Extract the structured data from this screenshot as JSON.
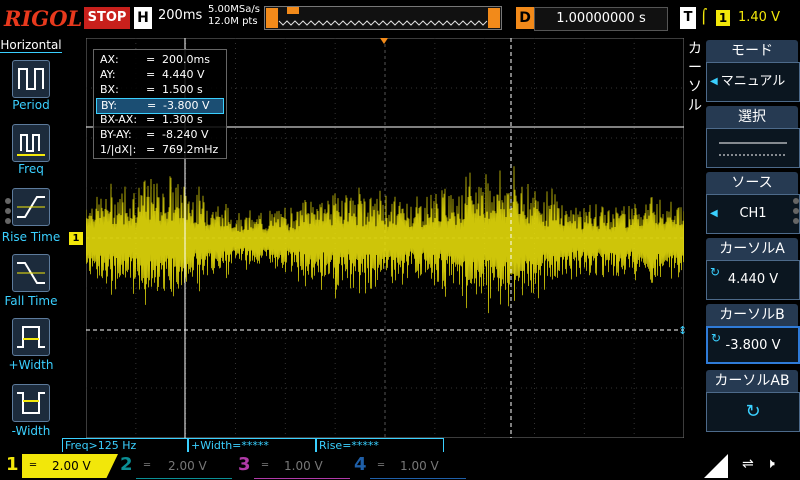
{
  "header": {
    "logo": "RIGOL",
    "run_status": "STOP",
    "timebase_label": "H",
    "timebase": "200ms",
    "sample_rate": "5.00MSa/s",
    "mem_depth": "12.0M pts",
    "delay_label": "D",
    "delay": "1.00000000 s",
    "trigger_label": "T",
    "trigger_source": "1",
    "trigger_level": "1.40 V"
  },
  "left_panel": {
    "title": "Horizontal",
    "items": [
      {
        "label": "Period"
      },
      {
        "label": "Freq"
      },
      {
        "label": "Rise Time"
      },
      {
        "label": "Fall Time"
      },
      {
        "label": "+Width"
      },
      {
        "label": "-Width"
      }
    ]
  },
  "cursor_readout": {
    "rows": [
      {
        "key": "AX:",
        "eq": "=",
        "val": "200.0ms"
      },
      {
        "key": "AY:",
        "eq": "=",
        "val": "4.440 V"
      },
      {
        "key": "BX:",
        "eq": "=",
        "val": "1.500 s"
      },
      {
        "key": "BY:",
        "eq": "=",
        "val": "-3.800 V"
      },
      {
        "key": "BX-AX:",
        "eq": "=",
        "val": "1.300 s"
      },
      {
        "key": "BY-AY:",
        "eq": "=",
        "val": "-8.240 V"
      },
      {
        "key": "1/|dX|:",
        "eq": "=",
        "val": "769.2mHz"
      }
    ]
  },
  "channel_marker": "1",
  "right_panel": {
    "title_chars": [
      "カ",
      "ー",
      "ソ",
      "ル"
    ],
    "menus": [
      {
        "head": "モード",
        "value": "マニュアル"
      },
      {
        "head": "選択",
        "value": ""
      },
      {
        "head": "ソース",
        "value": "CH1"
      },
      {
        "head": "カーソルA",
        "value": "4.440 V"
      },
      {
        "head": "カーソルB",
        "value": "-3.800 V"
      },
      {
        "head": "カーソルAB",
        "value": ""
      }
    ]
  },
  "status": {
    "freq": "Freq>125 Hz",
    "width": "+Width=*****",
    "rise": "Rise=*****"
  },
  "channels": [
    {
      "num": "1",
      "scale": "2.00 V",
      "color": "#f2e70a"
    },
    {
      "num": "2",
      "scale": "2.00 V",
      "color": "#0b8f95"
    },
    {
      "num": "3",
      "scale": "1.00 V",
      "color": "#b03aa8"
    },
    {
      "num": "4",
      "scale": "1.00 V",
      "color": "#1f5fa8"
    }
  ],
  "colors": {
    "ch1": "#f2e70a",
    "accent": "#3ad0ff",
    "stop": "#c8201c",
    "delay": "#f28a1a"
  }
}
